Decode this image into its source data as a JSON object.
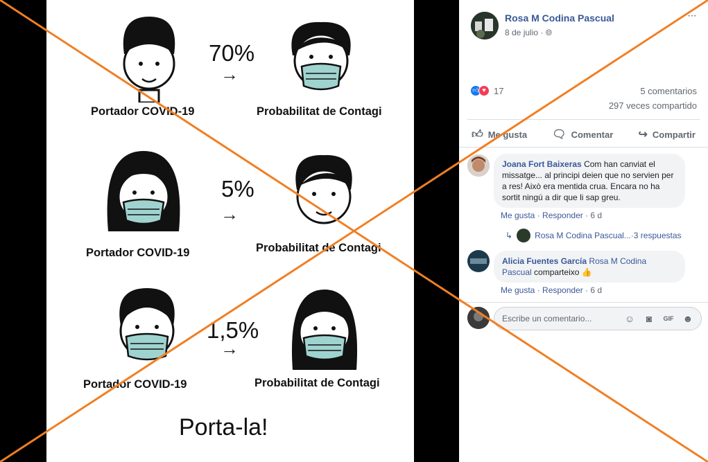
{
  "photo": {
    "rows": [
      {
        "percent": "70%",
        "left_label": "Portador COVID-19",
        "right_label": "Probabilitat de Contagi"
      },
      {
        "percent": "5%",
        "left_label": "Portador COVID-19",
        "right_label": "Probabilitat de Contagi"
      },
      {
        "percent": "1,5%",
        "left_label": "Portador COVID-19",
        "right_label": "Probabilitat de Contagi"
      }
    ],
    "footer": "Porta-la!",
    "arrow_glyph": "→"
  },
  "post": {
    "author": "Rosa M Codina Pascual",
    "date": "8 de julio · ",
    "more": "···",
    "reactions_count": "17",
    "comments_count": "5 comentarios",
    "shares_count": "297 veces compartido"
  },
  "actions": {
    "like": "Me gusta",
    "comment": "Comentar",
    "share": "Compartir"
  },
  "comments": [
    {
      "name": "Joana Fort Baixeras",
      "text": "Com han canviat el missatge... al principi deien que no servien per a res! Això era mentida crua. Encara no ha sortit ningú a dir que li sap greu.",
      "like": "Me gusta",
      "reply": "Responder",
      "time": "6 d"
    },
    {
      "name": "Alicia Fuentes García",
      "mention": "Rosa M Codina Pascual",
      "text": "comparteixo 👍",
      "like": "Me gusta",
      "reply": "Responder",
      "time": "6 d"
    }
  ],
  "replies": {
    "author": "Rosa M Codina Pascual...",
    "sep": " · ",
    "count": "3 respuestas"
  },
  "compose": {
    "placeholder": "Escribe un comentario..."
  },
  "colors": {
    "link": "#385898",
    "cross": "#f07f24",
    "like": "#1877f2",
    "love": "#f33e58",
    "mask": "#9fd3d0"
  }
}
